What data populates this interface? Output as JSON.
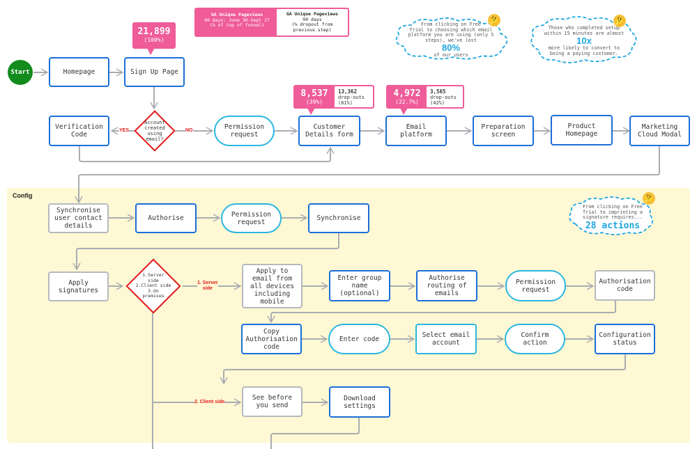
{
  "legend": {
    "funnel_title": "GA Unique Pageviews",
    "funnel_subtitle": "90 days: June 30-Sept 27",
    "funnel_note": "(% of top of funnel)",
    "dropout_title": "GA Unique Pageviews",
    "dropout_subtitle": "90 days",
    "dropout_note": "(% dropout from previous step)"
  },
  "colors": {
    "blue": "#1a6fd9",
    "gray": "#b5b9bd",
    "cyan": "#29b6e0",
    "red": "#e01b1b",
    "pink": "#ef5c99",
    "green": "#138c1e",
    "config_bg": "#fef8d4",
    "cloud": "#1ea7df"
  },
  "start_label": "Start",
  "nodes": {
    "homepage": "Homepage",
    "signup": "Sign Up Page",
    "verification": "Verification\nCode",
    "permission1": "Permission\nrequest",
    "customer_details": "Customer\nDetails form",
    "email_platform": "Email\nplatform",
    "preparation": "Preparation\nscreen",
    "product_home": "Product\nHomepage",
    "marketing_modal": "Marketing\nCloud Modal",
    "sync_contacts": "Synchronise\nuser contact\ndetails",
    "authorise": "Authorise",
    "permission2": "Permission\nrequest",
    "synchronise": "Synchronise",
    "apply_signatures": "Apply\nsignatures",
    "apply_all_devices": "Apply to\nemail from\nall devices\nincluding\nmobile",
    "group_name": "Enter group\nname\n(optional)",
    "authorise_routing": "Authorise\nrouting of\nemails",
    "permission3": "Permission\nrequest",
    "auth_code": "Authorisation\ncode",
    "copy_auth_code": "Copy\nAuthorisation\ncode",
    "enter_code": "Enter code",
    "select_email": "Select email\naccount",
    "confirm_action": "Confirm\naction",
    "config_status": "Configuration\nstatus",
    "see_before_send": "See before\nyou send",
    "download_settings": "Download\nsettings"
  },
  "decisions": {
    "account_email": "Account\ncreated\nusing\nemail?",
    "install_type": "1.Server\nside\n2.Client side\n3.On\npremises"
  },
  "edge_labels": {
    "yes": "YES",
    "no": "NO",
    "server_side": "1. Server\nside",
    "client_side": "2. Client side"
  },
  "stats": {
    "signup": {
      "value": "21,899",
      "percent": "(100%)"
    },
    "customer_details": {
      "value": "8,537",
      "percent": "(39%)",
      "dropouts": "13,362",
      "dropout_label": "drop-outs",
      "dropout_percent": "(61%)"
    },
    "email_platform": {
      "value": "4,972",
      "percent": "(22.7%)",
      "dropouts": "3,565",
      "dropout_label": "drop-outs",
      "dropout_percent": "(42%)"
    }
  },
  "callouts": {
    "lost_users": {
      "text": "From clicking on Free\nTrial to choosing which email\nplatform you are using (only 5\nsteps), we've lost",
      "big": "80%",
      "after": "of our users"
    },
    "setup_speed": {
      "text": "Those who completed setup\nwithin 15 minutes are almost",
      "big": "10x",
      "after": "more likely to convert to\nbeing a paying customer."
    },
    "actions": {
      "text": "From clicking on Free\nTrial to imprinting a\nsignature requires...",
      "big": "28 actions"
    },
    "emoji": "🤔"
  },
  "section_config": "Config"
}
